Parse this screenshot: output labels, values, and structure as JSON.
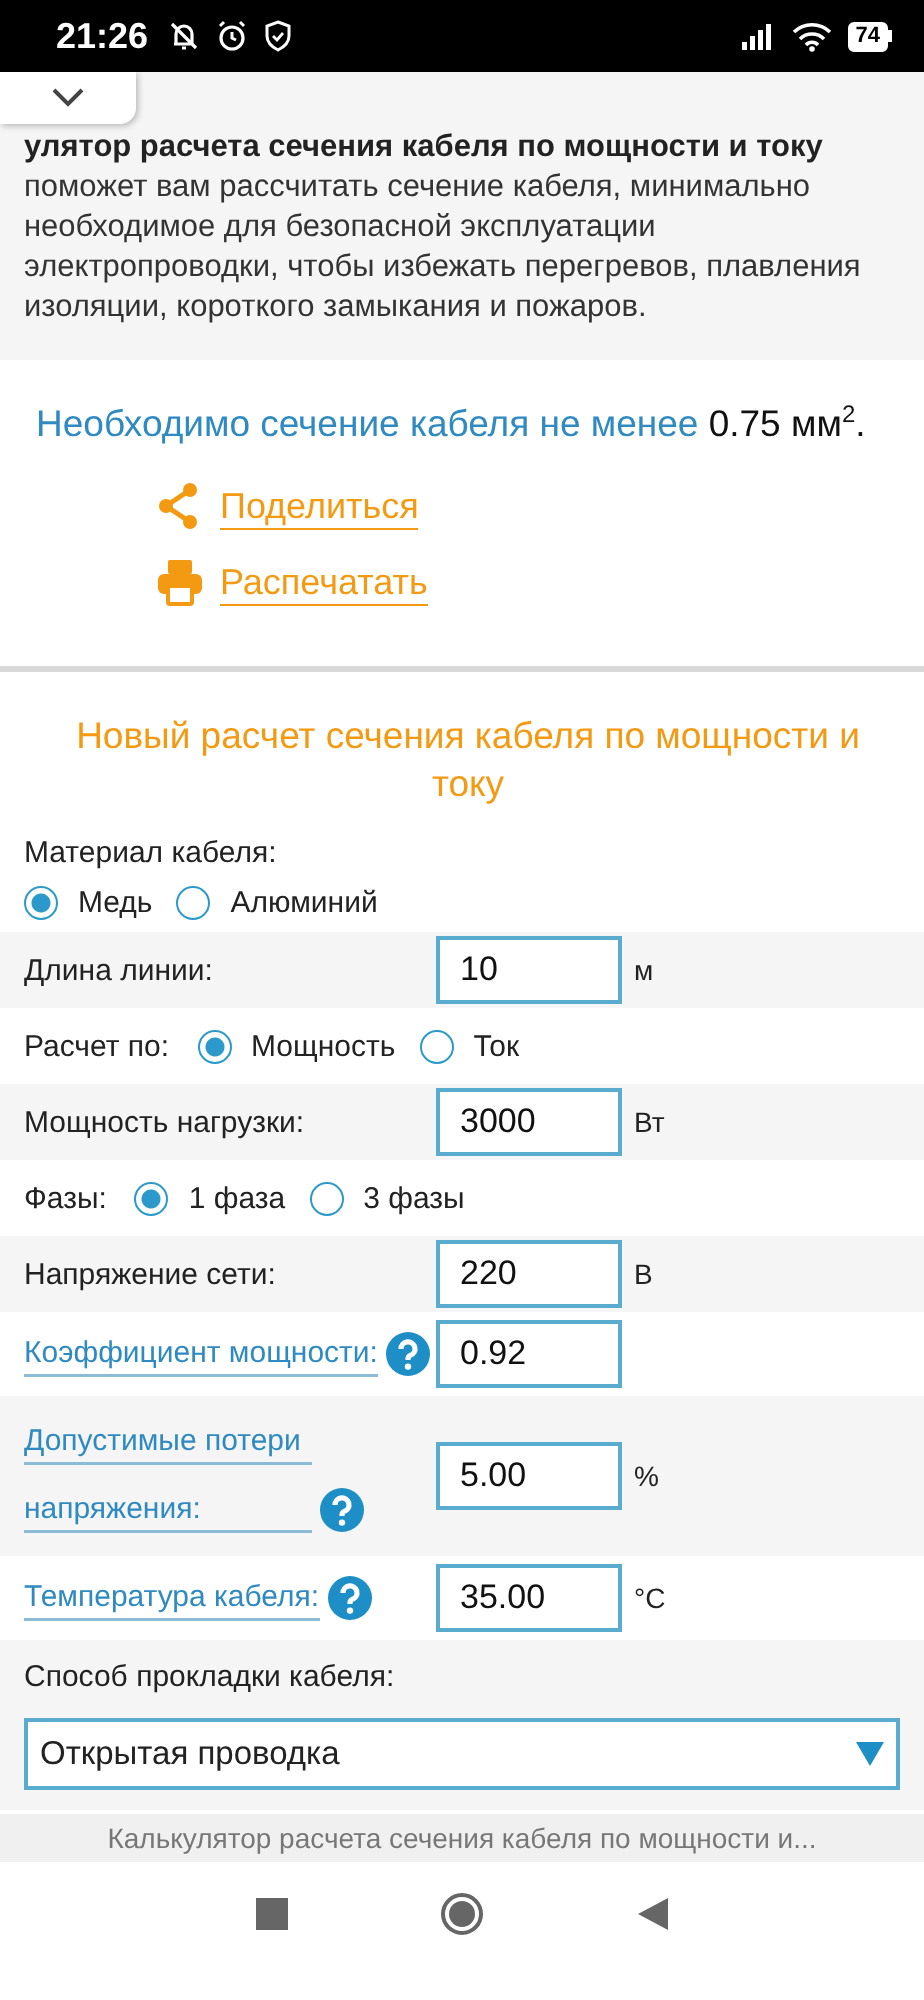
{
  "status_bar": {
    "time": "21:26",
    "battery": "74"
  },
  "intro": {
    "text": "**улятор расчета сечения кабеля по мощности и току** поможет вам рассчитать сечение кабеля, минимально необходимое для безопасной эксплуатации электропроводки, чтобы избежать перегревов, плавления изоляции, короткого замыкания и пожаров."
  },
  "result": {
    "text": "Необходимо сечение кабеля не менее",
    "value": "0.75 мм$^{2}$."
  },
  "actions": [
    {
      "kind": "share",
      "label": "Поделиться"
    },
    {
      "kind": "print",
      "label": "Распечатать"
    }
  ],
  "form": {
    "title": "Новый расчет сечения кабеля по мощности и току",
    "rows": [
      {
        "kind": "radio-stacked",
        "label": "Материал кабеля:",
        "options": [
          {
            "label": "Медь",
            "selected": true
          },
          {
            "label": "Алюминий",
            "selected": false
          }
        ]
      },
      {
        "kind": "input",
        "label": "Длина линии:",
        "value": "10",
        "unit": "м",
        "help": false
      },
      {
        "kind": "radio",
        "label": "Расчет по:",
        "options": [
          {
            "label": "Мощность",
            "selected": true
          },
          {
            "label": "Ток",
            "selected": false
          }
        ]
      },
      {
        "kind": "input",
        "label": "Мощность нагрузки:",
        "value": "3000",
        "unit": "Вт",
        "help": false
      },
      {
        "kind": "radio",
        "label": "Фазы:",
        "options": [
          {
            "label": "1 фаза",
            "selected": true
          },
          {
            "label": "3 фазы",
            "selected": false
          }
        ]
      },
      {
        "kind": "input",
        "label": "Напряжение сети:",
        "value": "220",
        "unit": "В",
        "help": false
      },
      {
        "kind": "input",
        "label": "Коэффициент мощности:",
        "value": "0.92",
        "help": true
      },
      {
        "kind": "input",
        "label": "Допустимые потери напряжения:",
        "value": "5.00",
        "unit": "%",
        "help": true
      },
      {
        "kind": "input",
        "label": "Температура кабеля:",
        "value": "35.00",
        "unit": "°C",
        "help": true
      },
      {
        "kind": "select",
        "label": "Способ прокладки кабеля:",
        "value": "Открытая проводка"
      }
    ]
  },
  "page_title": "Калькулятор расчета сечения кабеля по мощности и..."
}
